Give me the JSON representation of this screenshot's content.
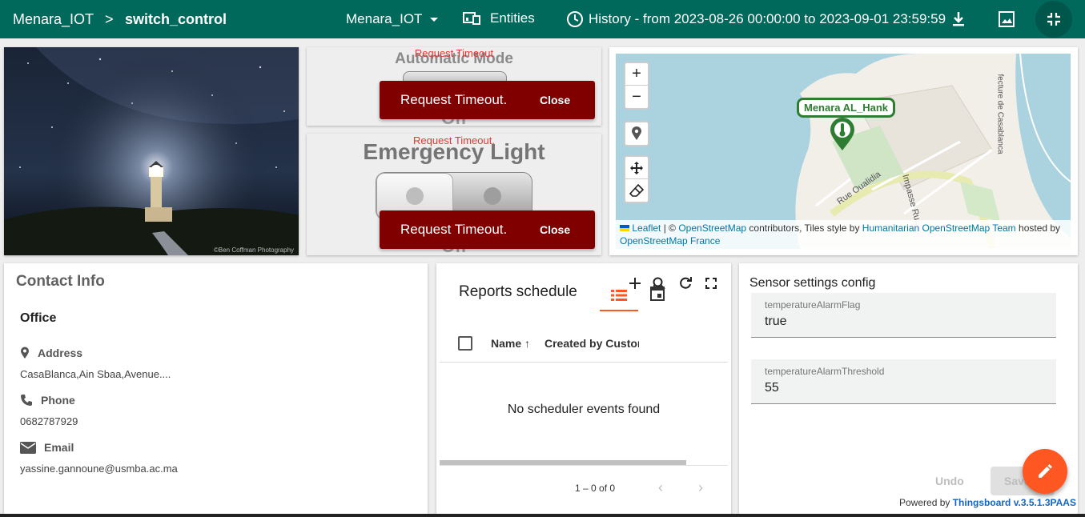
{
  "breadcrumb": {
    "root": "Menara_IOT",
    "separator": ">",
    "current": "switch_control"
  },
  "toolbar": {
    "state_select": "Menara_IOT",
    "entities_label": "Entities",
    "history_label": "History - from 2023-08-26 00:00:00 to 2023-09-01 23:59:59"
  },
  "image_widget": {
    "credit": "©Ben Coffman Photography"
  },
  "switch1": {
    "error": "Request Timeout",
    "title": "Automatic Mode",
    "state": "Off"
  },
  "switch2": {
    "error": "Request Timeout.",
    "title": "Emergency Light",
    "state": "Off"
  },
  "toast": {
    "message": "Request Timeout.",
    "close_label": "Close"
  },
  "map": {
    "zoom_in": "+",
    "zoom_out": "−",
    "marker_label": "Menara AL_Hank",
    "road1": "Rue Oualidia",
    "road2": "Impasse Ru...",
    "road3": "fecture de Casablanca",
    "attribution": {
      "leaflet": "Leaflet",
      "sep1": " | © ",
      "osm": "OpenStreetMap",
      "mid": " contributors, Tiles style by ",
      "hot": "Humanitarian OpenStreetMap Team",
      "hosted": " hosted by ",
      "osmfr": "OpenStreetMap France"
    }
  },
  "contact": {
    "title": "Contact Info",
    "office": "Office",
    "address_label": "Address",
    "address": "CasaBlanca,Ain Sbaa,Avenue....",
    "phone_label": "Phone",
    "phone": "0682787929",
    "email_label": "Email",
    "email": "yassine.gannoune@usmba.ac.ma"
  },
  "reports": {
    "title": "Reports schedule",
    "col_name": "Name",
    "col_created": "Created by Customer",
    "empty": "No scheduler events found",
    "pagination": "1 – 0 of 0"
  },
  "sensor": {
    "title": "Sensor settings config",
    "field1_label": "temperatureAlarmFlag",
    "field1_value": "true",
    "field2_label": "temperatureAlarmThreshold",
    "field2_value": "55",
    "undo": "Undo",
    "save": "Save",
    "powered": "Powered by ",
    "powered_link": "Thingsboard v.3.5.1.3PAAS"
  },
  "colors": {
    "primary": "#00695c",
    "accent": "#ff5722",
    "toast": "#800000",
    "error_text": "#e53935"
  }
}
